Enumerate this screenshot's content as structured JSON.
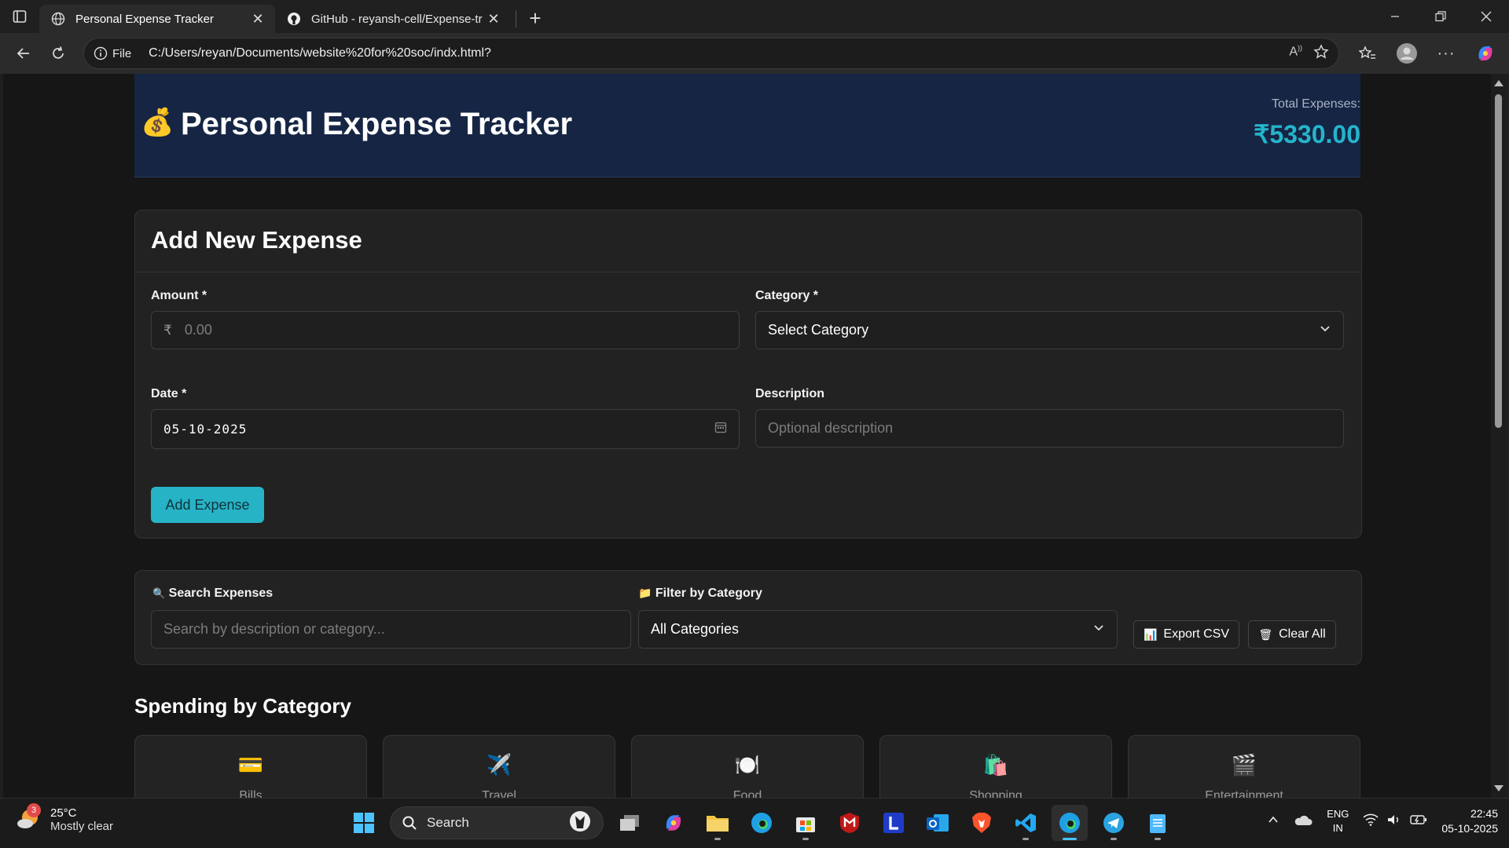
{
  "browser": {
    "tabs": [
      {
        "title": "Personal Expense Tracker",
        "active": true
      },
      {
        "title": "GitHub - reyansh-cell/Expense-tr",
        "active": false
      }
    ],
    "address": {
      "scheme_label": "File",
      "url": "C:/Users/reyan/Documents/website%20for%20soc/indx.html?"
    }
  },
  "header": {
    "logo_emoji": "💰",
    "title": "Personal Expense Tracker",
    "total_label": "Total Expenses:",
    "total_value": "₹5330.00"
  },
  "add_expense": {
    "heading": "Add New Expense",
    "amount": {
      "label": "Amount *",
      "prefix": "₹",
      "placeholder": "0.00"
    },
    "category": {
      "label": "Category *",
      "value": "Select Category"
    },
    "date": {
      "label": "Date *",
      "value": "05-10-2025"
    },
    "description": {
      "label": "Description",
      "placeholder": "Optional description"
    },
    "submit_label": "Add Expense"
  },
  "filters": {
    "search": {
      "label": "Search Expenses",
      "icon": "🔍",
      "placeholder": "Search by description or category..."
    },
    "category": {
      "label": "Filter by Category",
      "icon": "📁",
      "value": "All Categories"
    },
    "export_label": "Export CSV",
    "export_icon": "📊",
    "clear_label": "Clear All",
    "clear_icon": "🗑"
  },
  "spending": {
    "heading": "Spending by Category",
    "categories": [
      {
        "icon": "💳",
        "label": "Bills"
      },
      {
        "icon": "✈️",
        "label": "Travel"
      },
      {
        "icon": "🍽️",
        "label": "Food"
      },
      {
        "icon": "🛍️",
        "label": "Shopping"
      },
      {
        "icon": "🎬",
        "label": "Entertainment"
      }
    ]
  },
  "taskbar": {
    "weather": {
      "temp": "25°C",
      "condition": "Mostly clear",
      "badge": "3"
    },
    "search_label": "Search",
    "lang": {
      "line1": "ENG",
      "line2": "IN"
    },
    "clock": {
      "time": "22:45",
      "date": "05-10-2025"
    }
  },
  "colors": {
    "accent": "#26b3c6",
    "header_bg": "#162544",
    "total_value": "#24b5cc"
  }
}
